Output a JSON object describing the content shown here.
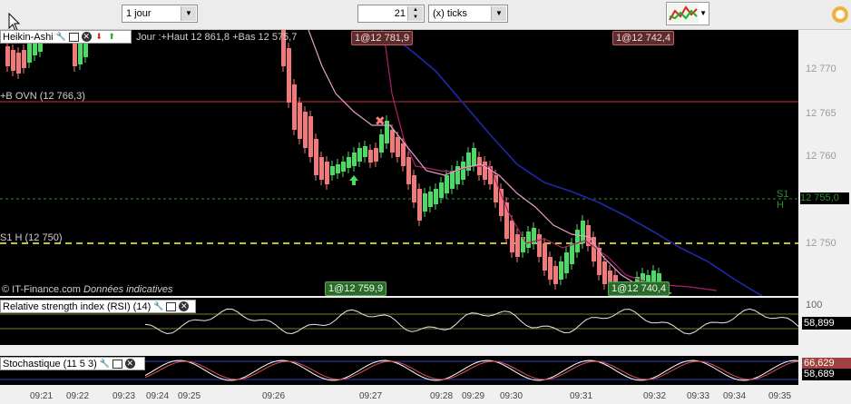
{
  "toolbar": {
    "period_value": "1 jour",
    "ticks_value": "21",
    "ticks_unit": "(x) ticks"
  },
  "main": {
    "indicator_title": "Heikin-Ashi",
    "info_line": "Jour :+Haut 12 861,8 +Bas 12 575,7",
    "ovn_label": "+B OVN (12 766,3)",
    "s1_label": "S1 H (12 750)",
    "s1_right_label": "S1 H",
    "s1_right_value": "12 755,0",
    "copyright": "© IT-Finance.com",
    "disclaimer": "Données indicatives",
    "trade_tags": {
      "top_left": "1@12 781,9",
      "top_right": "1@12 742,4",
      "bottom_left": "1@12 759,9",
      "bottom_right": "1@12 740,4"
    },
    "y_ticks": [
      "12 770",
      "12 765",
      "12 760",
      "12 750",
      "100"
    ]
  },
  "rsi": {
    "title": "Relative strength index (RSI) (14)",
    "value": "58,899"
  },
  "stoch": {
    "title": "Stochastique (11 5 3)",
    "value_top": "66,629",
    "value_bottom": "58,689"
  },
  "x_ticks": [
    "09:21",
    "09:22",
    "09:23",
    "09:24",
    "09:25",
    "09:26",
    "09:27",
    "09:28",
    "09:29",
    "09:30",
    "09:31",
    "09:32",
    "09:33",
    "09:34",
    "09:35"
  ],
  "colors": {
    "bull": "#4cd964",
    "bear": "#f07a7a",
    "ovn_line": "#c03030",
    "s1_line": "#ffff44",
    "s1_right": "#2f8f2f",
    "ma_slow": "#1d2aa8",
    "ma_fast": "#e6a0c8",
    "ma_band": "#b0206a"
  }
}
